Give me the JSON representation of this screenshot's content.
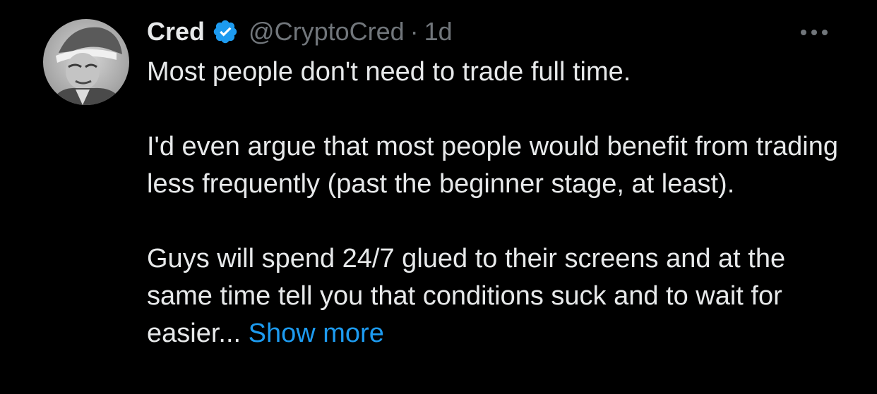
{
  "tweet": {
    "author": {
      "display_name": "Cred",
      "handle": "@CryptoCred",
      "verified": true
    },
    "separator": "·",
    "timestamp": "1d",
    "paragraphs": [
      "Most people don't need to trade full time.",
      "I'd even argue that most people would benefit from trading less frequently (past the beginner stage, at least).",
      "Guys will spend 24/7 glued to their screens and at the same time tell you that conditions suck and to wait for easier..."
    ],
    "show_more_label": "Show more",
    "icons": {
      "verified": "verified-badge-icon",
      "more": "more-options-icon"
    }
  },
  "colors": {
    "background": "#000000",
    "primary_text": "#e7e9ea",
    "secondary_text": "#71767b",
    "accent": "#1d9bf0"
  }
}
